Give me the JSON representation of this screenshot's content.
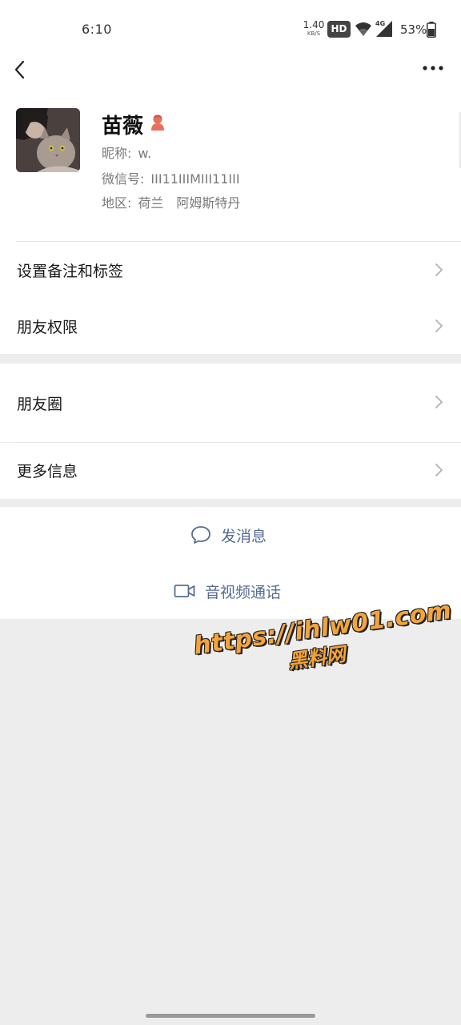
{
  "status_bar": {
    "time": "6:10",
    "net_speed": "1.40",
    "net_speed_unit": "KB/S",
    "hd_badge": "HD",
    "network_type": "4G",
    "battery_percent": "53%",
    "icons": [
      "wifi-icon",
      "signal-icon",
      "battery-icon"
    ]
  },
  "nav": {
    "back_icon": "chevron-left-icon",
    "more_icon": "more-dots-icon"
  },
  "profile": {
    "name": "苗薇",
    "gender_icon": "female-user-icon",
    "gender_color": "#e8715d",
    "nickname_label": "昵称:",
    "nickname_value": "w.",
    "wechat_id_label": "微信号:",
    "wechat_id_value": "III11IIIMIII11III",
    "region_label": "地区:",
    "region_province": "荷兰",
    "region_city": "阿姆斯特丹"
  },
  "menu": {
    "remark_tags": "设置备注和标签",
    "friend_permissions": "朋友权限",
    "moments": "朋友圈",
    "more_info": "更多信息"
  },
  "actions": {
    "send_message": "发消息",
    "send_message_icon": "chat-bubble-icon",
    "video_call": "音视频通话",
    "video_call_icon": "video-camera-icon",
    "accent_color": "#576b95"
  },
  "watermark": {
    "url": "https://ihlw01.com",
    "site": "黑料网",
    "color": "#f4a43a"
  }
}
